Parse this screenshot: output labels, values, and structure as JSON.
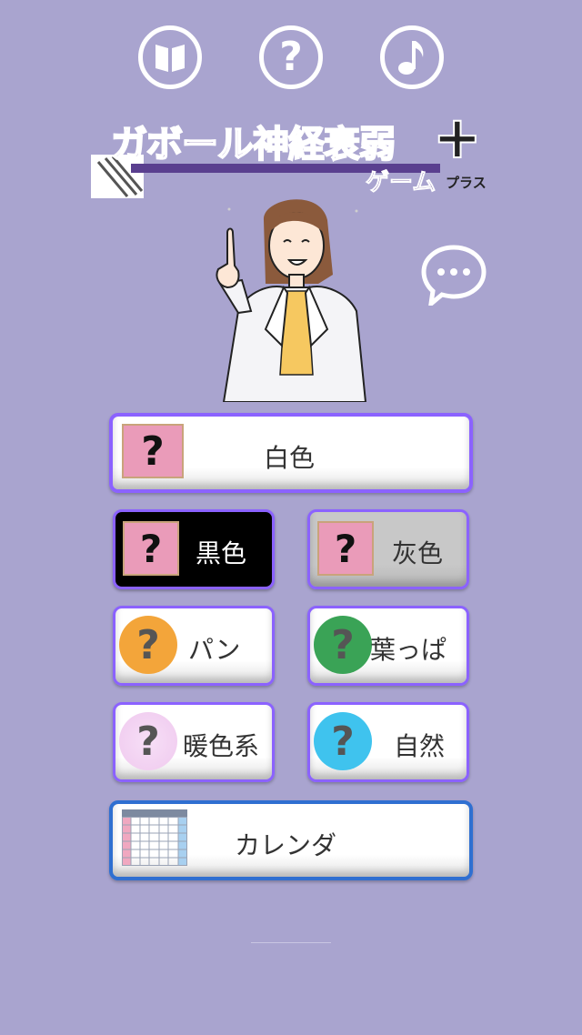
{
  "header_icons": {
    "book": "book-icon",
    "help": "question-icon",
    "sound": "music-note-icon"
  },
  "logo": {
    "title": "ガボール神経衰弱",
    "subtitle": "ゲーム",
    "plus_label": "プラス",
    "plus_symbol": "+"
  },
  "chat_icon": "chat-bubble-icon",
  "menu": {
    "white": "白色",
    "black": "黒色",
    "gray": "灰色",
    "bread": "パン",
    "leaf": "葉っぱ",
    "warm": "暖色系",
    "nature": "自然",
    "calendar": "カレンダ"
  },
  "question_mark": "?",
  "colors": {
    "background": "#a9a4cf",
    "button_border": "#8b62ff",
    "calendar_border": "#2f6fd1",
    "pink_square": "#ea9bb9",
    "orange": "#f3a53a",
    "green": "#3aa356",
    "lavender": "#f0d0f0",
    "cyan": "#3fc3ee"
  }
}
